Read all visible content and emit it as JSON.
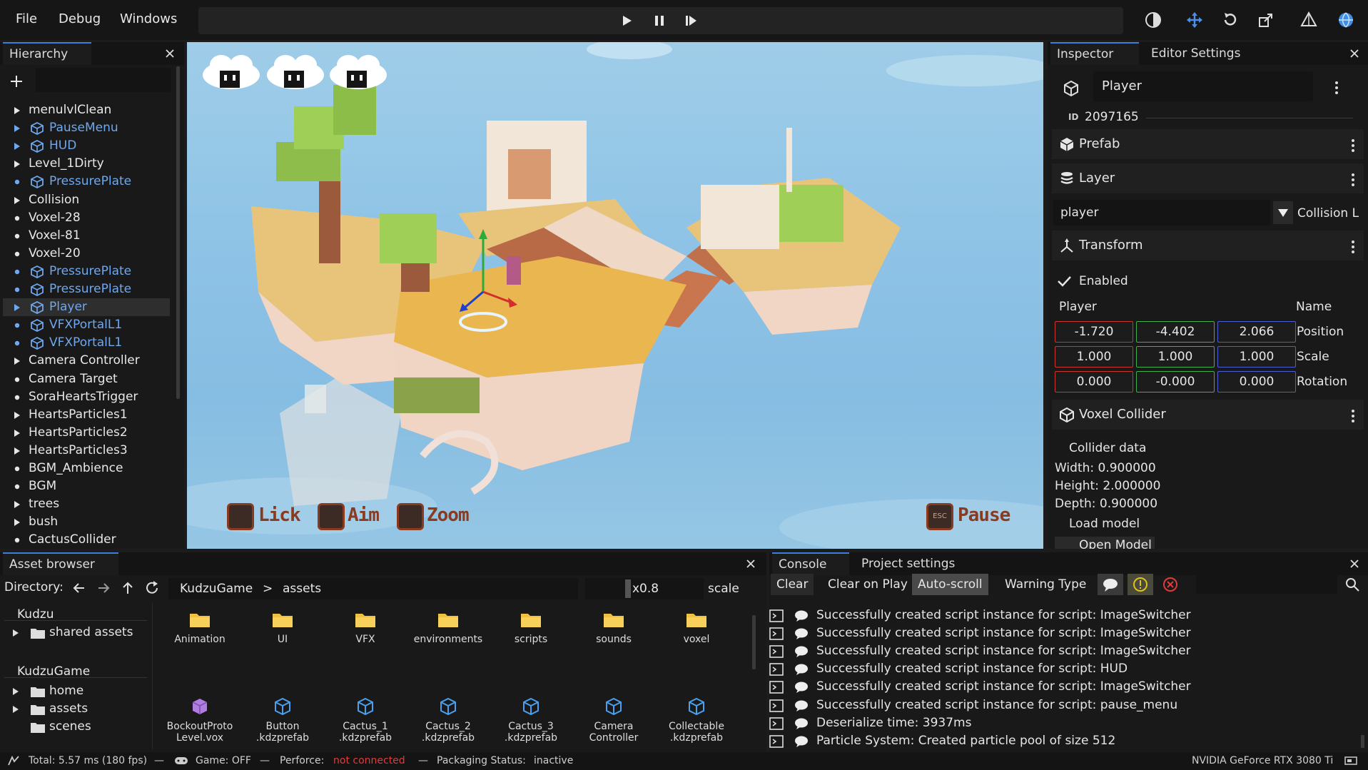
{
  "menubar": {
    "file": "File",
    "debug": "Debug",
    "windows": "Windows"
  },
  "hierarchy": {
    "tab": "Hierarchy",
    "items": [
      {
        "label": "menulvlClean",
        "kind": "folder",
        "prefab": false
      },
      {
        "label": "PauseMenu",
        "kind": "folder",
        "prefab": true
      },
      {
        "label": "HUD",
        "kind": "folder",
        "prefab": true
      },
      {
        "label": "Level_1Dirty",
        "kind": "folder",
        "prefab": false
      },
      {
        "label": "PressurePlate",
        "kind": "leaf",
        "prefab": true
      },
      {
        "label": "Collision",
        "kind": "folder",
        "prefab": false
      },
      {
        "label": "Voxel-28",
        "kind": "leaf",
        "prefab": false
      },
      {
        "label": "Voxel-81",
        "kind": "leaf",
        "prefab": false
      },
      {
        "label": "Voxel-20",
        "kind": "leaf",
        "prefab": false
      },
      {
        "label": "PressurePlate",
        "kind": "leaf",
        "prefab": true
      },
      {
        "label": "PressurePlate",
        "kind": "leaf",
        "prefab": true
      },
      {
        "label": "Player",
        "kind": "folder",
        "prefab": true
      },
      {
        "label": "VFXPortalL1",
        "kind": "leaf",
        "prefab": true
      },
      {
        "label": "VFXPortalL1",
        "kind": "leaf",
        "prefab": true
      },
      {
        "label": "Camera Controller",
        "kind": "folder",
        "prefab": false
      },
      {
        "label": "Camera Target",
        "kind": "leaf",
        "prefab": false
      },
      {
        "label": "SoraHeartsTrigger",
        "kind": "leaf",
        "prefab": false
      },
      {
        "label": "HeartsParticles1",
        "kind": "folder",
        "prefab": false
      },
      {
        "label": "HeartsParticles2",
        "kind": "folder",
        "prefab": false
      },
      {
        "label": "HeartsParticles3",
        "kind": "folder",
        "prefab": false
      },
      {
        "label": "BGM_Ambience",
        "kind": "leaf",
        "prefab": false
      },
      {
        "label": "BGM",
        "kind": "leaf",
        "prefab": false
      },
      {
        "label": "trees",
        "kind": "folder",
        "prefab": false
      },
      {
        "label": "bush",
        "kind": "folder",
        "prefab": false
      },
      {
        "label": "CactusCollider",
        "kind": "leaf",
        "prefab": false
      }
    ]
  },
  "viewport": {
    "hud": {
      "lick": "Lick",
      "aim": "Aim",
      "zoom": "Zoom",
      "pause": "Pause",
      "esc": "ESC"
    }
  },
  "inspector": {
    "tab_inspector": "Inspector",
    "tab_editor_settings": "Editor Settings",
    "name": "Player",
    "id": "2097165",
    "prefab": "Prefab",
    "layer": "Layer",
    "layer_value": "player",
    "collision_label": "Collision L",
    "transform": "Transform",
    "enabled": "Enabled",
    "object_label": "Player",
    "name_col": "Name",
    "position": {
      "label": "Position",
      "x": "-1.720",
      "y": "-4.402",
      "z": "2.066"
    },
    "scale": {
      "label": "Scale",
      "x": "1.000",
      "y": "1.000",
      "z": "1.000"
    },
    "rotation": {
      "label": "Rotation",
      "x": "0.000",
      "y": "-0.000",
      "z": "0.000"
    },
    "voxel_collider": "Voxel Collider",
    "collider_data": "Collider data",
    "width": "Width: 0.900000",
    "height": "Height: 2.000000",
    "depth": "Depth: 0.900000",
    "load_model": "Load model",
    "open_model": "Open Model"
  },
  "asset_browser": {
    "tab": "Asset browser",
    "directory_label": "Directory:",
    "crumbs": [
      "KudzuGame",
      ">",
      "assets"
    ],
    "zoom": "x0.8",
    "scale_label": "scale",
    "tree": {
      "kudzu": "Kudzu",
      "shared": "shared assets",
      "kudzugame": "KudzuGame",
      "home": "home",
      "assets": "assets",
      "scenes": "scenes"
    },
    "folders": [
      "Animation",
      "UI",
      "VFX",
      "environments",
      "scripts",
      "sounds",
      "voxel"
    ],
    "files": [
      {
        "l1": "BockoutProto",
        "l2": "Level.vox",
        "kind": "vox"
      },
      {
        "l1": "Button",
        "l2": ".kdzprefab",
        "kind": "prefab"
      },
      {
        "l1": "Cactus_1",
        "l2": ".kdzprefab",
        "kind": "prefab"
      },
      {
        "l1": "Cactus_2",
        "l2": ".kdzprefab",
        "kind": "prefab"
      },
      {
        "l1": "Cactus_3",
        "l2": ".kdzprefab",
        "kind": "prefab"
      },
      {
        "l1": "Camera",
        "l2": "Controller",
        "kind": "prefab"
      },
      {
        "l1": "Collectable",
        "l2": ".kdzprefab",
        "kind": "prefab"
      }
    ]
  },
  "console": {
    "tab_console": "Console",
    "tab_project": "Project settings",
    "clear": "Clear",
    "clear_on_play": "Clear on Play",
    "auto_scroll": "Auto-scroll",
    "warning_type": "Warning Type",
    "messages": [
      "Successfully created script instance for script: ImageSwitcher",
      "Successfully created script instance for script: ImageSwitcher",
      "Successfully created script instance for script: ImageSwitcher",
      "Successfully created script instance for script: HUD",
      "Successfully created script instance for script: ImageSwitcher",
      "Successfully created script instance for script: pause_menu",
      "Deserialize time: 3937ms",
      "Particle System: Created particle pool of size 512"
    ]
  },
  "statusbar": {
    "total": "Total: 5.57 ms (180 fps)",
    "dash": "—",
    "game": "Game: OFF",
    "perforce": "Perforce:",
    "perforce_state": "not connected",
    "packaging": "Packaging Status:",
    "packaging_state": "inactive",
    "gpu": "NVIDIA GeForce RTX 3080 Ti"
  },
  "colors": {
    "accent": "#3a7fd9",
    "prefab": "#6ea8f0",
    "error": "#e23b3b",
    "warning": "#e0c21c"
  }
}
